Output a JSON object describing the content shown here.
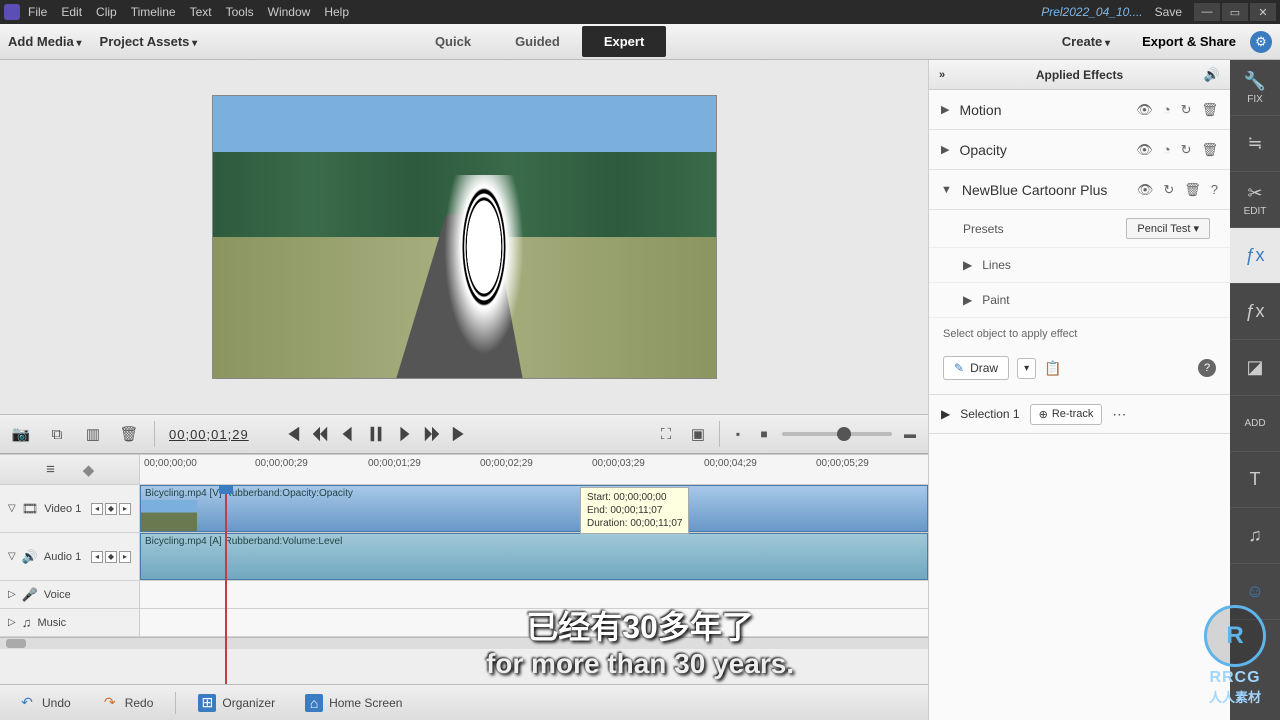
{
  "titlebar": {
    "menus": [
      "File",
      "Edit",
      "Clip",
      "Timeline",
      "Text",
      "Tools",
      "Window",
      "Help"
    ],
    "filename": "Prel2022_04_10....",
    "save": "Save"
  },
  "toolbar": {
    "add_media": "Add Media",
    "project_assets": "Project Assets",
    "modes": {
      "quick": "Quick",
      "guided": "Guided",
      "expert": "Expert"
    },
    "create": "Create",
    "export": "Export & Share"
  },
  "controls": {
    "timecode": "00;00;01;29"
  },
  "ruler": {
    "ticks": [
      "00;00;00;00",
      "00;00;00;29",
      "00;00;01;29",
      "00;00;02;29",
      "00;00;03;29",
      "00;00;04;29",
      "00;00;05;29"
    ]
  },
  "tracks": {
    "video1": {
      "name": "Video 1",
      "clip": "Bicycling.mp4 [V] Rubberband:Opacity:Opacity"
    },
    "audio1": {
      "name": "Audio 1",
      "clip": "Bicycling.mp4 [A] Rubberband:Volume:Level"
    },
    "voice": {
      "name": "Voice"
    },
    "music": {
      "name": "Music"
    }
  },
  "tooltip": {
    "start": "Start: 00;00;00;00",
    "end": "End: 00;00;11;07",
    "dur": "Duration: 00;00;11;07"
  },
  "footer": {
    "undo": "Undo",
    "redo": "Redo",
    "organizer": "Organizer",
    "home": "Home Screen"
  },
  "effects": {
    "title": "Applied Effects",
    "motion": "Motion",
    "opacity": "Opacity",
    "newblue": "NewBlue Cartoonr Plus",
    "presets_label": "Presets",
    "preset_value": "Pencil Test",
    "lines": "Lines",
    "paint": "Paint",
    "select_label": "Select object to apply effect",
    "draw": "Draw",
    "selection": "Selection 1",
    "retrack": "Re-track"
  },
  "rside": {
    "fix": "FIX",
    "edit": "EDIT",
    "add": "ADD"
  },
  "subtitle": {
    "cn": "已经有30多年了",
    "en": "for more than 30 years."
  },
  "watermark": {
    "abbr": "R",
    "line1": "RRCG",
    "line2": "人人素材"
  }
}
